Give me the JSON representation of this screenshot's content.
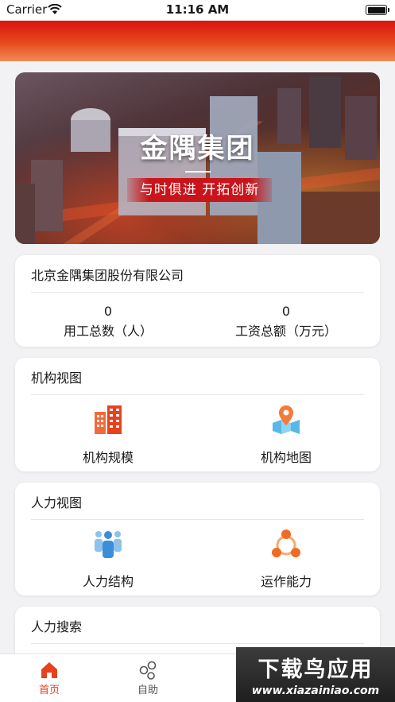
{
  "status_bar": {
    "carrier": "Carrier",
    "time": "11:16 AM"
  },
  "banner": {
    "title": "金隅集团",
    "slogan": "与时俱进  开拓创新"
  },
  "company_card": {
    "name": "北京金隅集团股份有限公司",
    "stats": [
      {
        "value": "0",
        "label": "用工总数（人）"
      },
      {
        "value": "0",
        "label": "工资总额（万元）"
      }
    ]
  },
  "org_view": {
    "title": "机构视图",
    "items": [
      {
        "label": "机构规模",
        "icon": "buildings-icon"
      },
      {
        "label": "机构地图",
        "icon": "map-pin-icon"
      }
    ]
  },
  "hr_view": {
    "title": "人力视图",
    "items": [
      {
        "label": "人力结构",
        "icon": "people-group-icon"
      },
      {
        "label": "运作能力",
        "icon": "network-nodes-icon"
      }
    ]
  },
  "hr_search": {
    "title": "人力搜索"
  },
  "tab_bar": {
    "tabs": [
      {
        "label": "首页",
        "icon": "home-icon",
        "active": true
      },
      {
        "label": "自助",
        "icon": "self-service-icon",
        "active": false
      }
    ]
  },
  "watermark": {
    "main": "下载鸟应用",
    "url": "www.xiazainiao.com"
  },
  "colors": {
    "accent": "#e8411c",
    "tab_active": "#e8411c",
    "tab_inactive": "#555555"
  }
}
